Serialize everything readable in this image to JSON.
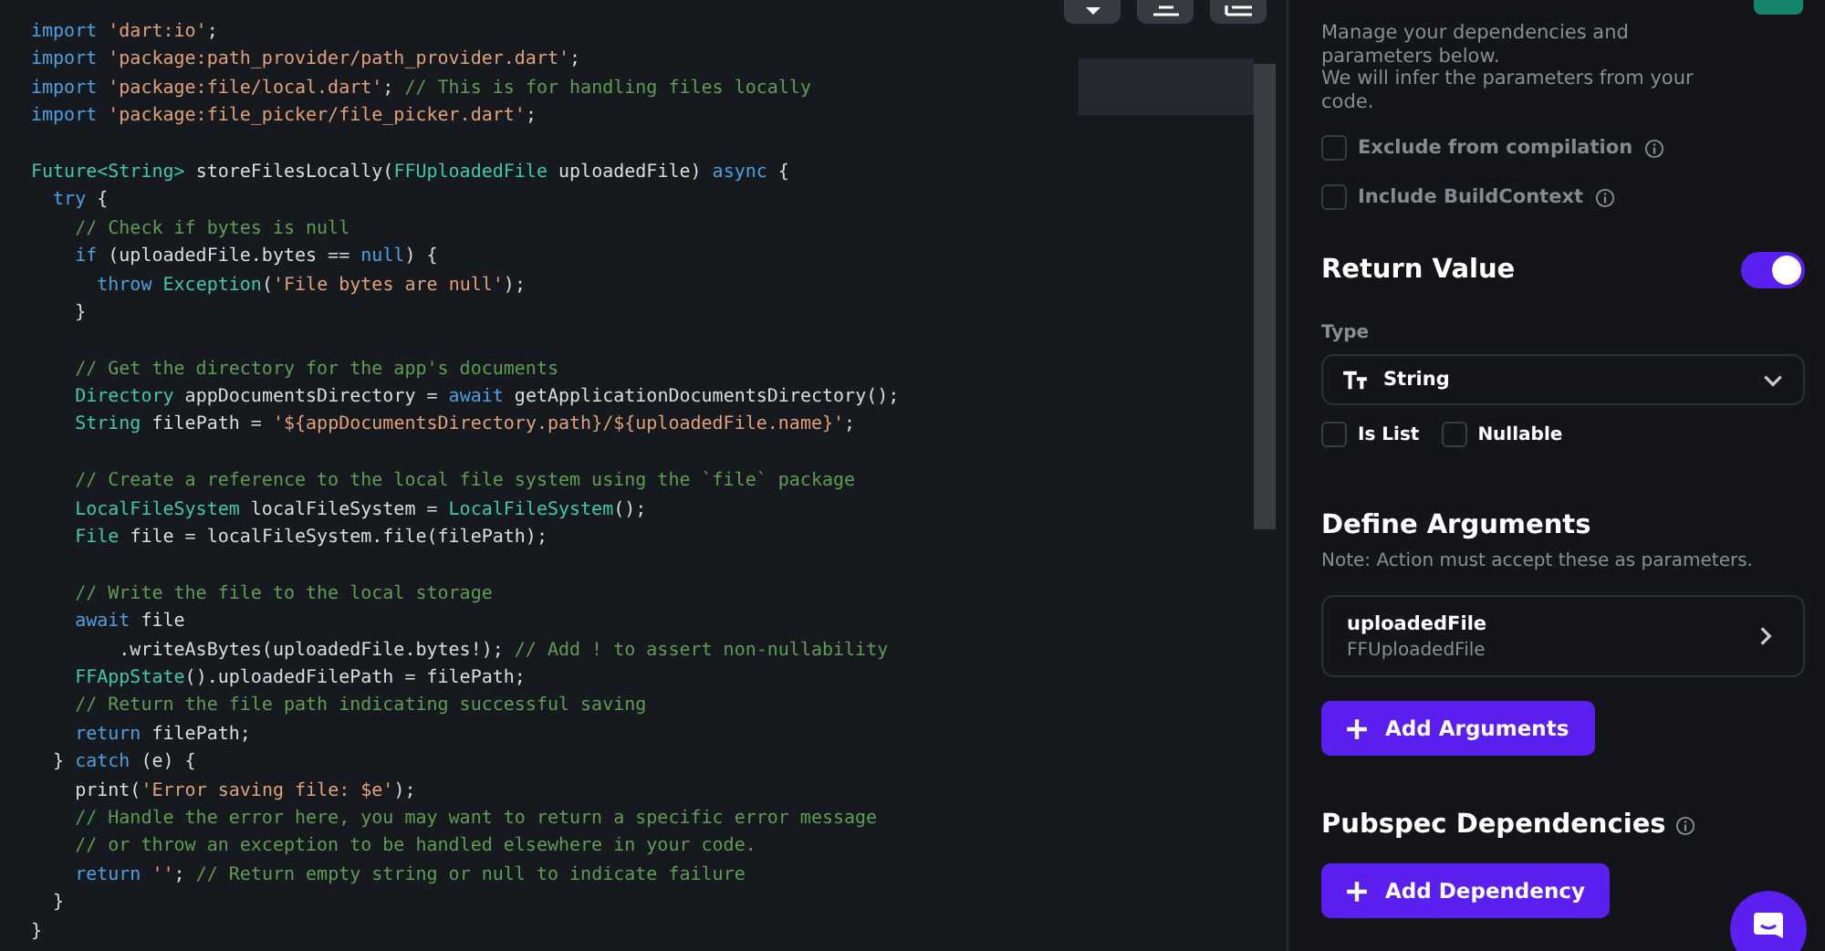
{
  "editor": {
    "lines": [
      {
        "kind": "code",
        "tokens": [
          {
            "kind": "kw",
            "text": "import"
          },
          {
            "kind": "str",
            "text": " 'dart:io'"
          },
          {
            "kind": "plain",
            "text": ";"
          }
        ]
      },
      {
        "kind": "code",
        "tokens": [
          {
            "kind": "kw",
            "text": "import"
          },
          {
            "kind": "str",
            "text": " 'package:path_provider/path_provider.dart'"
          },
          {
            "kind": "plain",
            "text": ";"
          }
        ]
      },
      {
        "kind": "code",
        "tokens": [
          {
            "kind": "kw",
            "text": "import"
          },
          {
            "kind": "str",
            "text": " 'package:file/local.dart'"
          },
          {
            "kind": "plain",
            "text": "; "
          },
          {
            "kind": "cmt",
            "text": "// This is for handling files locally"
          }
        ]
      },
      {
        "kind": "code",
        "tokens": [
          {
            "kind": "kw",
            "text": "import"
          },
          {
            "kind": "str",
            "text": " 'package:file_picker/file_picker.dart'"
          },
          {
            "kind": "plain",
            "text": ";"
          }
        ]
      },
      {
        "kind": "blank"
      },
      {
        "kind": "code",
        "tokens": [
          {
            "kind": "type",
            "text": "Future<String>"
          },
          {
            "kind": "plain",
            "text": " storeFilesLocally("
          },
          {
            "kind": "type",
            "text": "FFUploadedFile"
          },
          {
            "kind": "plain",
            "text": " uploadedFile) "
          },
          {
            "kind": "kw",
            "text": "async"
          },
          {
            "kind": "plain",
            "text": " {"
          }
        ]
      },
      {
        "kind": "code",
        "tokens": [
          {
            "kind": "kw",
            "text": "  try"
          },
          {
            "kind": "plain",
            "text": " {"
          }
        ]
      },
      {
        "kind": "code",
        "tokens": [
          {
            "kind": "cmt",
            "text": "    // Check if bytes is null"
          }
        ]
      },
      {
        "kind": "code",
        "tokens": [
          {
            "kind": "kw",
            "text": "    if"
          },
          {
            "kind": "plain",
            "text": " (uploadedFile.bytes == "
          },
          {
            "kind": "kw",
            "text": "null"
          },
          {
            "kind": "plain",
            "text": ") {"
          }
        ]
      },
      {
        "kind": "code",
        "tokens": [
          {
            "kind": "kw",
            "text": "      throw"
          },
          {
            "kind": "type",
            "text": " Exception"
          },
          {
            "kind": "plain",
            "text": "("
          },
          {
            "kind": "str",
            "text": "'File bytes are null'"
          },
          {
            "kind": "plain",
            "text": ");"
          }
        ]
      },
      {
        "kind": "code",
        "tokens": [
          {
            "kind": "plain",
            "text": "    }"
          }
        ]
      },
      {
        "kind": "blank"
      },
      {
        "kind": "code",
        "tokens": [
          {
            "kind": "cmt",
            "text": "    // Get the directory for the app's documents"
          }
        ]
      },
      {
        "kind": "code",
        "tokens": [
          {
            "kind": "type",
            "text": "    Directory"
          },
          {
            "kind": "plain",
            "text": " appDocumentsDirectory = "
          },
          {
            "kind": "kw",
            "text": "await"
          },
          {
            "kind": "plain",
            "text": " getApplicationDocumentsDirectory();"
          }
        ]
      },
      {
        "kind": "code",
        "tokens": [
          {
            "kind": "type",
            "text": "    String"
          },
          {
            "kind": "plain",
            "text": " filePath = "
          },
          {
            "kind": "str",
            "text": "'${appDocumentsDirectory.path}/${uploadedFile.name}'"
          },
          {
            "kind": "plain",
            "text": ";"
          }
        ]
      },
      {
        "kind": "blank"
      },
      {
        "kind": "code",
        "tokens": [
          {
            "kind": "cmt",
            "text": "    // Create a reference to the local file system using the `file` package"
          }
        ]
      },
      {
        "kind": "code",
        "tokens": [
          {
            "kind": "type",
            "text": "    LocalFileSystem"
          },
          {
            "kind": "plain",
            "text": " localFileSystem = "
          },
          {
            "kind": "type",
            "text": "LocalFileSystem"
          },
          {
            "kind": "plain",
            "text": "();"
          }
        ]
      },
      {
        "kind": "code",
        "tokens": [
          {
            "kind": "type",
            "text": "    File"
          },
          {
            "kind": "plain",
            "text": " file = localFileSystem.file(filePath);"
          }
        ]
      },
      {
        "kind": "blank"
      },
      {
        "kind": "code",
        "tokens": [
          {
            "kind": "cmt",
            "text": "    // Write the file to the local storage"
          }
        ]
      },
      {
        "kind": "code",
        "tokens": [
          {
            "kind": "kw",
            "text": "    await"
          },
          {
            "kind": "plain",
            "text": " file"
          }
        ]
      },
      {
        "kind": "code",
        "tokens": [
          {
            "kind": "plain",
            "text": "        .writeAsBytes(uploadedFile.bytes!); "
          },
          {
            "kind": "cmt",
            "text": "// Add ! to assert non-nullability"
          }
        ]
      },
      {
        "kind": "code",
        "tokens": [
          {
            "kind": "type",
            "text": "    FFAppState"
          },
          {
            "kind": "plain",
            "text": "().uploadedFilePath = filePath;"
          }
        ]
      },
      {
        "kind": "code",
        "tokens": [
          {
            "kind": "cmt",
            "text": "    // Return the file path indicating successful saving"
          }
        ]
      },
      {
        "kind": "code",
        "tokens": [
          {
            "kind": "kw",
            "text": "    return"
          },
          {
            "kind": "plain",
            "text": " filePath;"
          }
        ]
      },
      {
        "kind": "code",
        "tokens": [
          {
            "kind": "plain",
            "text": "  } "
          },
          {
            "kind": "kw",
            "text": "catch"
          },
          {
            "kind": "plain",
            "text": " (e) {"
          }
        ]
      },
      {
        "kind": "code",
        "tokens": [
          {
            "kind": "plain",
            "text": "    print("
          },
          {
            "kind": "str",
            "text": "'Error saving file: $e'"
          },
          {
            "kind": "plain",
            "text": ");"
          }
        ]
      },
      {
        "kind": "code",
        "tokens": [
          {
            "kind": "cmt",
            "text": "    // Handle the error here, you may want to return a specific error message"
          }
        ]
      },
      {
        "kind": "code",
        "tokens": [
          {
            "kind": "cmt",
            "text": "    // or throw an exception to be handled elsewhere in your code."
          }
        ]
      },
      {
        "kind": "code",
        "tokens": [
          {
            "kind": "kw",
            "text": "    return"
          },
          {
            "kind": "str",
            "text": " ''"
          },
          {
            "kind": "plain",
            "text": "; "
          },
          {
            "kind": "cmt",
            "text": "// Return empty string or null to indicate failure"
          }
        ]
      },
      {
        "kind": "code",
        "tokens": [
          {
            "kind": "plain",
            "text": "  }"
          }
        ]
      },
      {
        "kind": "code",
        "tokens": [
          {
            "kind": "plain",
            "text": "}"
          }
        ]
      }
    ]
  },
  "panel": {
    "description": [
      "Manage your dependencies and parameters below.",
      "We will infer the parameters from your code."
    ],
    "options": [
      {
        "label": "Exclude from compilation",
        "checked": false
      },
      {
        "label": "Include BuildContext",
        "checked": false
      }
    ],
    "return_value": {
      "title": "Return Value",
      "on": true,
      "type_label": "Type",
      "type": "String",
      "flags": [
        {
          "label": "Is List",
          "checked": false
        },
        {
          "label": "Nullable",
          "checked": false
        }
      ]
    },
    "arguments": {
      "title": "Define Arguments",
      "note": "Note: Action must accept these as parameters.",
      "items": [
        {
          "name": "uploadedFile",
          "type": "FFUploadedFile"
        }
      ],
      "button": "Add Arguments"
    },
    "dependencies": {
      "title": "Pubspec Dependencies",
      "button": "Add Dependency"
    }
  }
}
